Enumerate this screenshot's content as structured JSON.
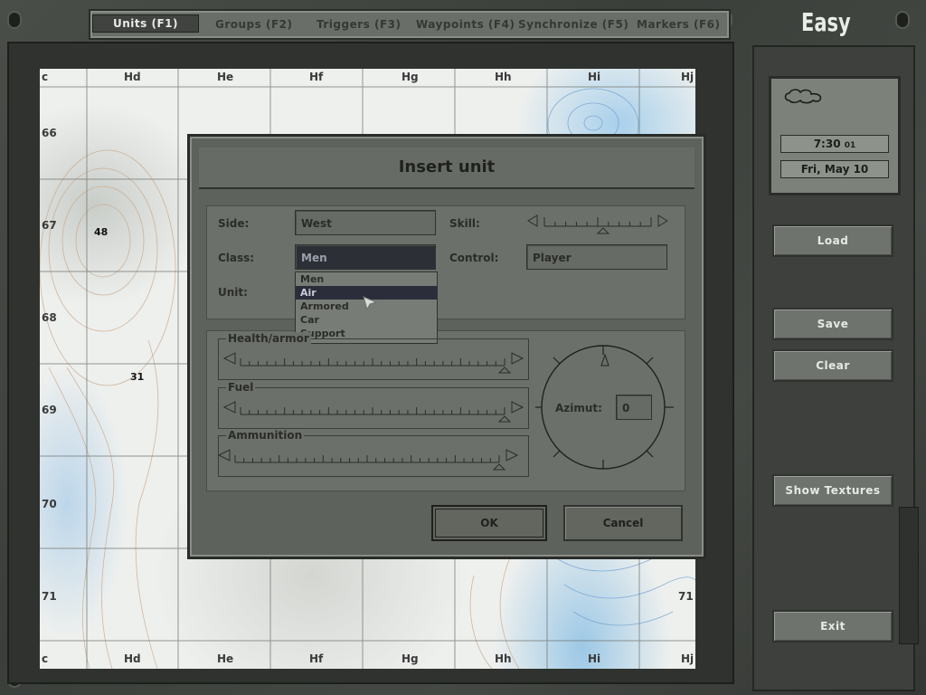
{
  "tabs": [
    {
      "label": "Units  (F1)",
      "active": true
    },
    {
      "label": "Groups  (F2)",
      "active": false
    },
    {
      "label": "Triggers  (F3)",
      "active": false
    },
    {
      "label": "Waypoints  (F4)",
      "active": false
    },
    {
      "label": "Synchronize  (F5)",
      "active": false
    },
    {
      "label": "Markers  (F6)",
      "active": false
    }
  ],
  "difficulty": "Easy",
  "map": {
    "col_labels": [
      "c",
      "Hd",
      "He",
      "Hf",
      "Hg",
      "Hh",
      "Hi",
      "Hj"
    ],
    "row_labels": [
      "66",
      "67",
      "68",
      "69",
      "70",
      "71"
    ],
    "right_row_label": "71",
    "spot_heights": [
      "48",
      "31"
    ]
  },
  "info": {
    "weather_icon": "cloud-icon",
    "time": "7:30",
    "time_seconds": "01",
    "date": "Fri,  May  10"
  },
  "side_buttons": {
    "load": "Load",
    "save": "Save",
    "clear": "Clear",
    "show_textures": "Show  Textures",
    "exit": "Exit"
  },
  "dialog": {
    "title": "Insert unit",
    "side_label": "Side:",
    "side_value": "West",
    "skill_label": "Skill:",
    "class_label": "Class:",
    "class_value": "Men",
    "control_label": "Control:",
    "control_value": "Player",
    "unit_label": "Unit:",
    "class_options": [
      {
        "label": "Men",
        "selected": false
      },
      {
        "label": "Air",
        "selected": true
      },
      {
        "label": "Armored",
        "selected": false
      },
      {
        "label": "Car",
        "selected": false
      },
      {
        "label": "Support",
        "selected": false
      }
    ],
    "health_label": "Health/armor",
    "fuel_label": "Fuel",
    "ammo_label": "Ammunition",
    "azimut_label": "Azimut:",
    "azimut_value": "0",
    "ok": "OK",
    "cancel": "Cancel",
    "skill_level": 0.55,
    "health_level": 1.0,
    "fuel_level": 1.0,
    "ammo_level": 1.0
  }
}
